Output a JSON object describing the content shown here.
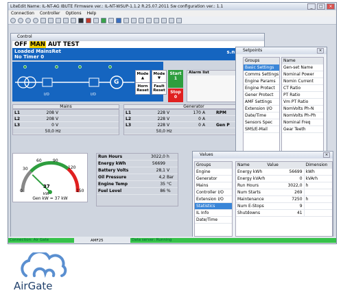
{
  "window": {
    "title": "LiteEdit Name: IL-NT-AG IBUTE Firmware ver.: IL-NT-WSUP-1.1.2 R.25.07.2011 Sw configuration ver.: 1.1"
  },
  "menu": [
    "Connection",
    "Controller",
    "Options",
    "Help"
  ],
  "control": {
    "title": "Control",
    "modes": {
      "off": "OFF",
      "man": "MAN",
      "aut": "AUT",
      "test": "TEST"
    },
    "status1": "Loaded MainsRet",
    "status2": "No Timer 0",
    "sn": "s.n.",
    "buttons": {
      "mode_up": "Mode",
      "mode_down": "Mode",
      "horn_reset": "Horn Reset",
      "fault_reset": "Fault Reset",
      "start": "Start",
      "start_val": "1",
      "stop": "Stop",
      "stop_val": "0",
      "io1": "I/O",
      "io2": "I/O",
      "gen": "G"
    },
    "alarm_list": "Alarm list"
  },
  "mains": {
    "header": "Mains",
    "rows": [
      {
        "k": "L1",
        "v": "208",
        "u": "V"
      },
      {
        "k": "L2",
        "v": "208",
        "u": "V"
      },
      {
        "k": "L3",
        "v": "0",
        "u": "V"
      }
    ],
    "freq": "50,0",
    "freq_u": "Hz"
  },
  "generator": {
    "header": "Generator",
    "rows": [
      {
        "k": "L1",
        "v": "228",
        "u": "V",
        "a": "170",
        "au": "A"
      },
      {
        "k": "L2",
        "v": "228",
        "u": "V",
        "a": "0",
        "au": "A"
      },
      {
        "k": "L3",
        "v": "228",
        "u": "V",
        "a": "0",
        "au": "A"
      }
    ],
    "freq": "50,0",
    "freq_u": "Hz",
    "rpm": "RPM",
    "genpf": "Gen P"
  },
  "gauge": {
    "ticks": [
      "0",
      "30",
      "60",
      "90",
      "120",
      "150"
    ],
    "value": "37",
    "unit": "kW",
    "caption": "Gen kW = 37 kW",
    "value_num": 37,
    "max": 150
  },
  "run": {
    "rows": [
      {
        "k": "Run Hours",
        "v": "3022,0",
        "u": "h"
      },
      {
        "k": "Energy kWh",
        "v": "56699",
        "u": ""
      },
      {
        "k": "Battery Volts",
        "v": "28,1",
        "u": "V"
      },
      {
        "k": "Oil Pressure",
        "v": "4,2",
        "u": "Bar"
      },
      {
        "k": "Engine Temp",
        "v": "35",
        "u": "°C"
      },
      {
        "k": "Fuel Level",
        "v": "86",
        "u": "%"
      }
    ]
  },
  "setpoints": {
    "title": "Setpoints",
    "col1": "Groups",
    "col2": "Name",
    "groups": [
      "Basic Settings",
      "Comms Settings",
      "Engine Params",
      "Engine Protect",
      "Gener Protect",
      "AMF Settings",
      "Extension I/O",
      "Date/Time",
      "Sensors Spec",
      "SMS/E-Mail"
    ],
    "names": [
      "Gen-set Name",
      "Nominal Power",
      "Nomin Current",
      "CT Ratio",
      "PT Ratio",
      "Vm PT Ratio",
      "NomVolts Ph-N",
      "NomVolts Ph-Ph",
      "Nominal Freq",
      "Gear Teeth"
    ]
  },
  "values": {
    "title": "Values",
    "col_groups": "Groups",
    "col_name": "Name",
    "col_value": "Value",
    "col_dim": "Dimension",
    "groups": [
      "Engine",
      "Generator",
      "Mains",
      "Controller I/O",
      "Extension I/O",
      "Statistics",
      "IL Info",
      "Date/Time"
    ],
    "rows": [
      {
        "n": "Energy kWh",
        "v": "56699",
        "u": "kWh"
      },
      {
        "n": "Energy kVArh",
        "v": "0",
        "u": "kVArh"
      },
      {
        "n": "Run Hours",
        "v": "3022,0",
        "u": "h"
      },
      {
        "n": "Num Starts",
        "v": "269",
        "u": ""
      },
      {
        "n": "Maintenance",
        "v": "7250",
        "u": "h"
      },
      {
        "n": "Num E-Stops",
        "v": "9",
        "u": ""
      },
      {
        "n": "Shutdowns",
        "v": "41",
        "u": ""
      }
    ]
  },
  "status": {
    "left": "Connection: Air Gate",
    "mid": "AMF25",
    "right": "Data server: Running"
  },
  "logo": {
    "text": "AirGate"
  },
  "colors": {
    "blue": "#1565c0",
    "green": "#2e9e3e",
    "red": "#e02020",
    "yellow": "#f4d000"
  }
}
